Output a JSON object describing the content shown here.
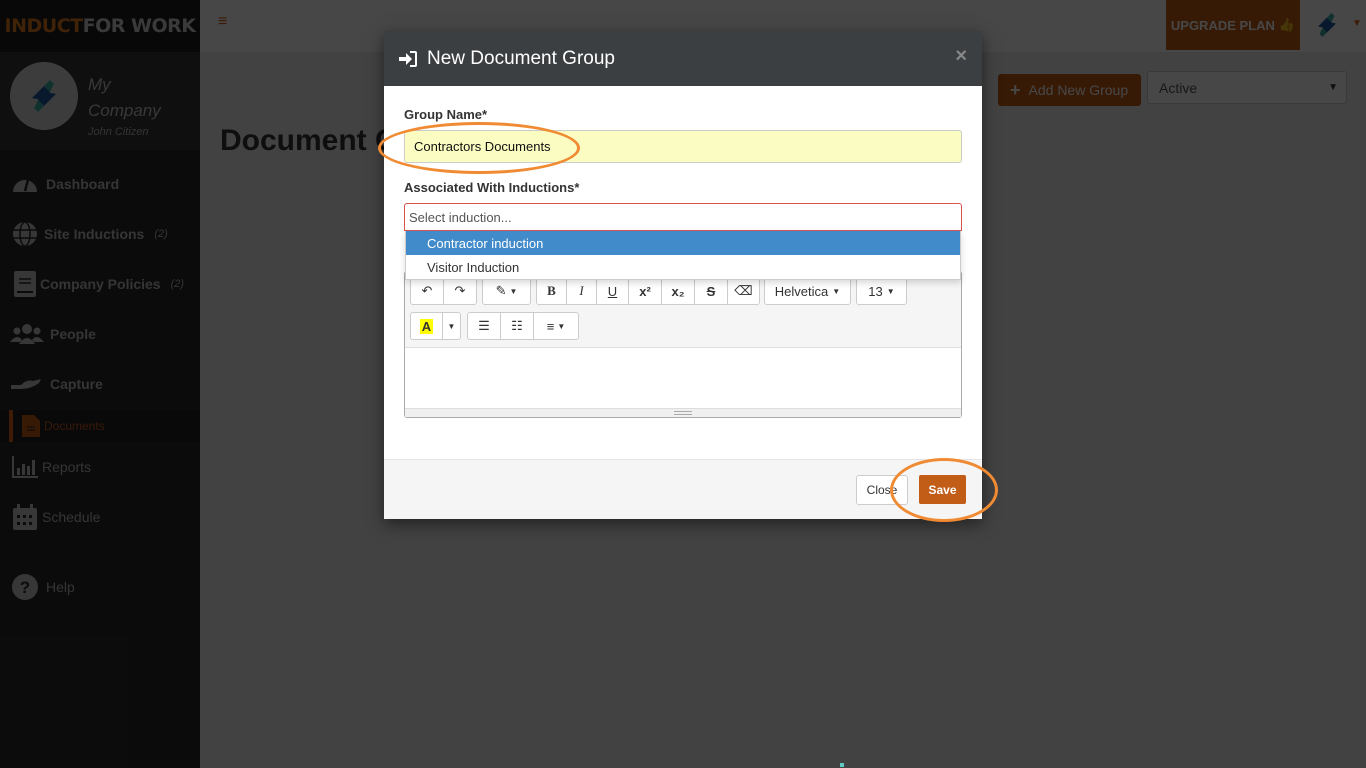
{
  "app": {
    "logo_part1": "INDUCT",
    "logo_part2": "FOR WORK",
    "company_name": "My Company",
    "user_name": "John Citizen"
  },
  "sidebar": {
    "items": [
      {
        "label": "Dashboard",
        "icon": "dashboard-icon",
        "count": ""
      },
      {
        "label": "Site Inductions",
        "icon": "globe-icon",
        "count": "(2)"
      },
      {
        "label": "Company Policies",
        "icon": "book-icon",
        "count": "(2)"
      },
      {
        "label": "People",
        "icon": "people-icon",
        "count": ""
      },
      {
        "label": "Capture",
        "icon": "hand-icon",
        "count": ""
      },
      {
        "label": "Documents",
        "icon": "document-icon",
        "count": "",
        "active": true
      },
      {
        "label": "Reports",
        "icon": "bar-chart-icon",
        "count": ""
      },
      {
        "label": "Schedule",
        "icon": "calendar-icon",
        "count": ""
      },
      {
        "label": "Help",
        "icon": "help-icon",
        "count": ""
      }
    ]
  },
  "topbar": {
    "menu_icon": "hamburger-icon",
    "upgrade_label": "UPGRADE PLAN",
    "upgrade_icon": "thumbs-up-icon"
  },
  "page": {
    "title": "Document Groups",
    "add_group_label": "Add New Group",
    "status_filter": "Active"
  },
  "modal": {
    "title": "New Document Group",
    "title_icon": "sign-in-icon",
    "close_symbol": "×",
    "group_name_label": "Group Name*",
    "group_name_value": "Contractors Documents",
    "inductions_label": "Associated With Inductions*",
    "inductions_placeholder": "Select induction...",
    "induction_options": [
      {
        "label": "Contractor induction",
        "highlighted": true
      },
      {
        "label": "Visitor Induction",
        "highlighted": false
      }
    ],
    "editor": {
      "font_family": "Helvetica",
      "font_size": "13",
      "bold": "B",
      "italic": "I",
      "underline": "U",
      "superscript": "x²",
      "subscript": "x₂",
      "strikethrough": "S",
      "highlight_letter": "A"
    },
    "close_button": "Close",
    "save_button": "Save"
  },
  "colors": {
    "brand_orange": "#c25d18",
    "highlight_blue": "#428bca",
    "annotation_orange": "#f08a33",
    "input_yellow": "#fafcc2"
  }
}
